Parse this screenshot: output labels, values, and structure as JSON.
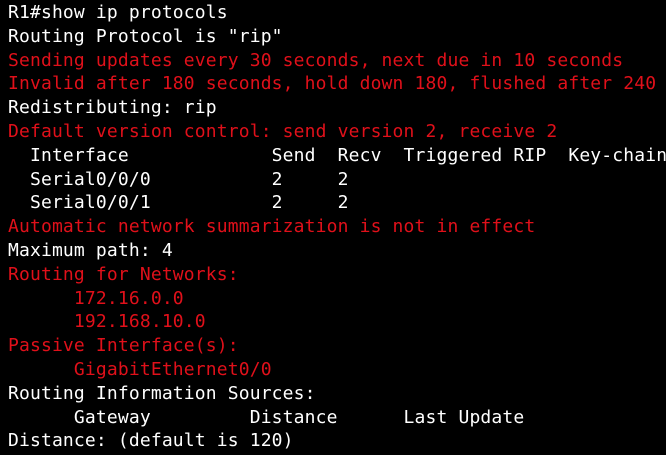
{
  "colors": {
    "background": "#000000",
    "normal_text": "#ffffff",
    "highlight_text": "#e0101a"
  },
  "terminal": {
    "lines": [
      {
        "text": "R1#show ip protocols",
        "color": "white"
      },
      {
        "text": "Routing Protocol is \"rip\"",
        "color": "white"
      },
      {
        "text": "Sending updates every 30 seconds, next due in 10 seconds",
        "color": "red"
      },
      {
        "text": "Invalid after 180 seconds, hold down 180, flushed after 240",
        "color": "red"
      },
      {
        "text": "Redistributing: rip",
        "color": "white"
      },
      {
        "text": "Default version control: send version 2, receive 2",
        "color": "red"
      },
      {
        "text": "  Interface             Send  Recv  Triggered RIP  Key-chain",
        "color": "white"
      },
      {
        "text": "  Serial0/0/0           2     2",
        "color": "white"
      },
      {
        "text": "  Serial0/0/1           2     2",
        "color": "white"
      },
      {
        "text": "Automatic network summarization is not in effect",
        "color": "red"
      },
      {
        "text": "Maximum path: 4",
        "color": "white"
      },
      {
        "text": "Routing for Networks:",
        "color": "red"
      },
      {
        "text": "      172.16.0.0",
        "color": "red"
      },
      {
        "text": "      192.168.10.0",
        "color": "red"
      },
      {
        "text": "Passive Interface(s):",
        "color": "red"
      },
      {
        "text": "      GigabitEthernet0/0",
        "color": "red"
      },
      {
        "text": "Routing Information Sources:",
        "color": "white"
      },
      {
        "text": "      Gateway         Distance      Last Update",
        "color": "white"
      },
      {
        "text": "Distance: (default is 120)",
        "color": "white"
      }
    ]
  }
}
